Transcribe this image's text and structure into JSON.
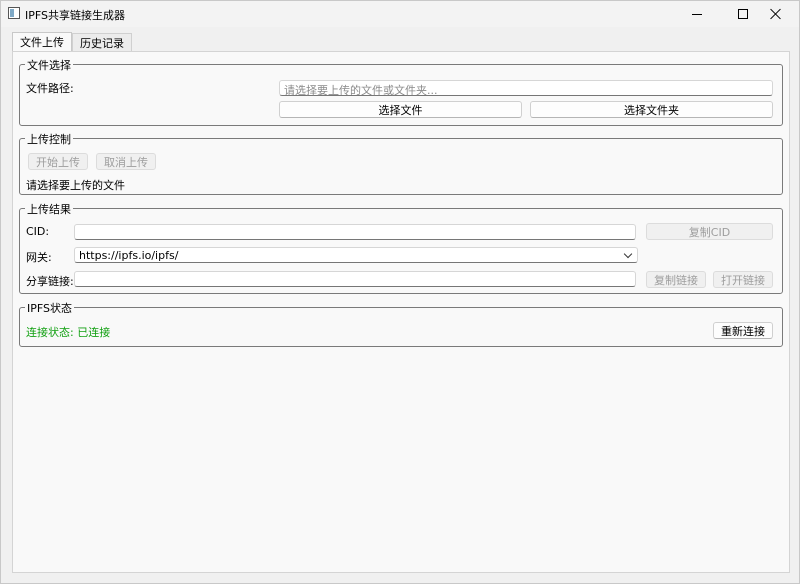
{
  "window": {
    "title": "IPFS共享链接生成器"
  },
  "tabs": [
    {
      "label": "文件上传",
      "active": true
    },
    {
      "label": "历史记录",
      "active": false
    }
  ],
  "file_select": {
    "group_title": "文件选择",
    "path_label": "文件路径:",
    "path_value": "",
    "path_placeholder": "请选择要上传的文件或文件夹...",
    "select_file_label": "选择文件",
    "select_folder_label": "选择文件夹"
  },
  "upload_control": {
    "group_title": "上传控制",
    "start_label": "开始上传",
    "cancel_label": "取消上传",
    "status_text": "请选择要上传的文件"
  },
  "upload_result": {
    "group_title": "上传结果",
    "cid_label": "CID:",
    "cid_value": "",
    "copy_cid_label": "复制CID",
    "gateway_label": "网关:",
    "gateway_value": "https://ipfs.io/ipfs/",
    "share_label": "分享链接:",
    "share_value": "",
    "copy_link_label": "复制链接",
    "open_link_label": "打开链接"
  },
  "ipfs_status": {
    "group_title": "IPFS状态",
    "status_text": "连接状态: 已连接",
    "status_color": "#11a011",
    "reconnect_label": "重新连接"
  }
}
